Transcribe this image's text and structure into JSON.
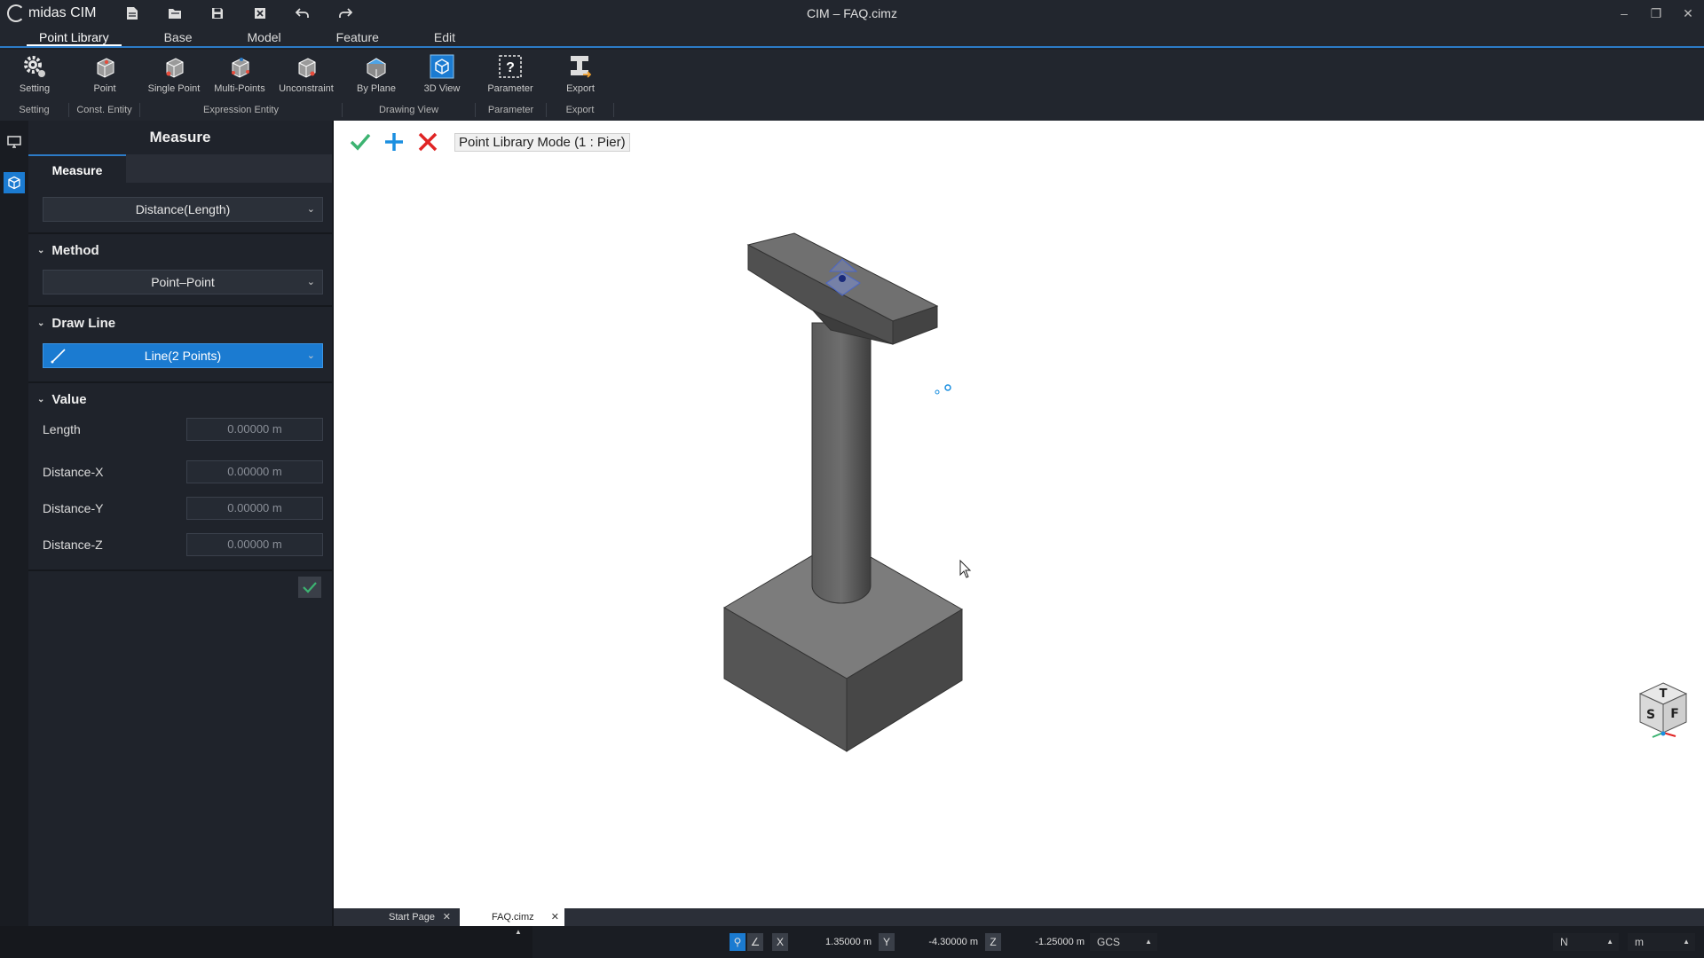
{
  "app": {
    "name": "midas CIM",
    "window_title": "CIM – FAQ.cimz"
  },
  "ribbon_tabs": [
    "Point Library",
    "Base",
    "Model",
    "Feature",
    "Edit"
  ],
  "ribbon_buttons": {
    "setting": "Setting",
    "point": "Point",
    "single_point": "Single Point",
    "multi_points": "Multi-Points",
    "unconstraint": "Unconstraint",
    "by_plane": "By Plane",
    "view_3d": "3D View",
    "parameter": "Parameter",
    "export": "Export"
  },
  "ribbon_groups": {
    "setting": "Setting",
    "const_entity": "Const. Entity",
    "expression_entity": "Expression Entity",
    "drawing_view": "Drawing View",
    "parameter": "Parameter",
    "export": "Export"
  },
  "panel": {
    "title": "Measure",
    "tab": "Measure",
    "measure_type": "Distance(Length)",
    "method_header": "Method",
    "method_value": "Point–Point",
    "draw_line_header": "Draw Line",
    "draw_line_value": "Line(2 Points)",
    "value_header": "Value",
    "rows": [
      {
        "label": "Length",
        "value": "0.00000 m"
      },
      {
        "label": "Distance-X",
        "value": "0.00000 m"
      },
      {
        "label": "Distance-Y",
        "value": "0.00000 m"
      },
      {
        "label": "Distance-Z",
        "value": "0.00000 m"
      }
    ]
  },
  "viewport": {
    "mode_label": "Point Library Mode (1 : Pier)",
    "cube_faces": {
      "top": "T",
      "left": "S",
      "right": "F"
    }
  },
  "doc_tabs": [
    "Start Page",
    "FAQ.cimz"
  ],
  "status": {
    "x_label": "X",
    "x_value": "1.35000 m",
    "y_label": "Y",
    "y_value": "-4.30000 m",
    "z_label": "Z",
    "z_value": "-1.25000 m",
    "coord_system": "GCS",
    "force_unit": "N",
    "length_unit": "m"
  },
  "colors": {
    "accent": "#2c7bc7",
    "check": "#3cb371",
    "plus": "#1b8fe0",
    "cancel": "#e02424"
  }
}
